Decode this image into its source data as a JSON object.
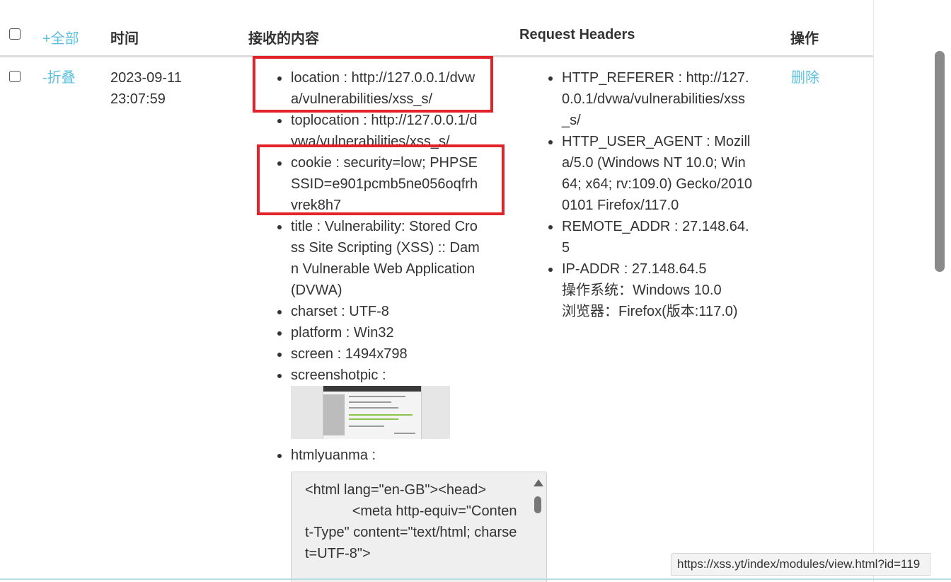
{
  "table": {
    "headers": {
      "expand_all": "+全部",
      "time": "时间",
      "content": "接收的内容",
      "request_headers": "Request Headers",
      "actions": "操作"
    }
  },
  "row": {
    "collapse": "-折叠",
    "date": "2023-09-11",
    "clock": "23:07:59",
    "content_items": {
      "location": "location : http://127.0.0.1/dvwa/vulnerabilities/xss_s/",
      "toplocation": "toplocation : http://127.0.0.1/dvwa/vulnerabilities/xss_s/",
      "cookie": "cookie : security=low; PHPSESSID=e901pcmb5ne056oqfrhvrek8h7",
      "title": "title : Vulnerability: Stored Cross Site Scripting (XSS) :: Damn Vulnerable Web Application (DVWA)",
      "charset": "charset : UTF-8",
      "platform": "platform : Win32",
      "screen": "screen : 1494x798",
      "screenshotpic": "screenshotpic :",
      "htmlyuanma": "htmlyuanma :"
    },
    "html_source": "<html lang=\"en-GB\"><head>\n            <meta http-equiv=\"Content-Type\" content=\"text/html; charset=UTF-8\">",
    "headers_items": {
      "referer": "HTTP_REFERER : http://127.0.0.1/dvwa/vulnerabilities/xss_s/",
      "user_agent": "HTTP_USER_AGENT : Mozilla/5.0 (Windows NT 10.0; Win64; x64; rv:109.0) Gecko/20100101 Firefox/117.0",
      "remote_addr": "REMOTE_ADDR : 27.148.64.5",
      "ip_addr": "IP-ADDR : 27.148.64.5",
      "os": "操作系统：Windows 10.0",
      "browser": "浏览器：Firefox(版本:117.0)"
    },
    "delete": "删除"
  },
  "status_bar": {
    "url": "https://xss.yt/index/modules/view.html?id=119"
  },
  "colors": {
    "link": "#5bc0de",
    "highlight_box": "#e2242a",
    "text": "#333333"
  }
}
